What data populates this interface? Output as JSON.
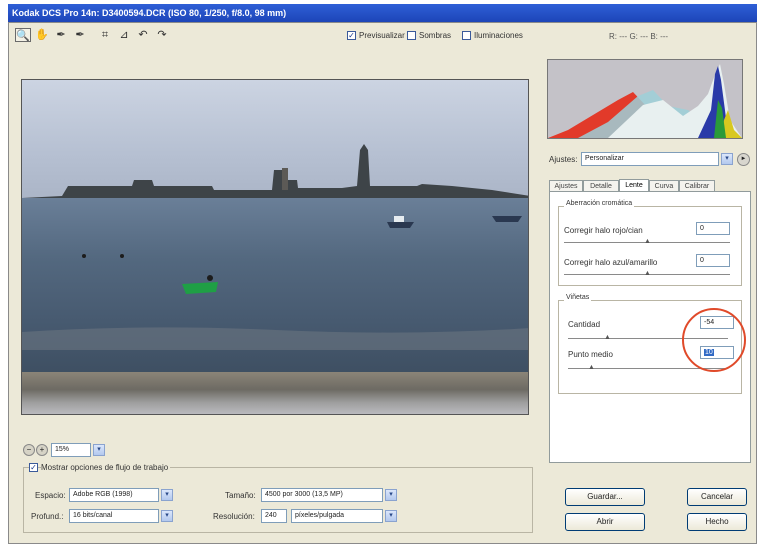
{
  "window": {
    "title": "Kodak DCS Pro 14n:  D3400594.DCR  (ISO 80, 1/250, f/8.0, 98 mm)"
  },
  "toolbar": {
    "tools": [
      {
        "name": "zoom-icon",
        "glyph": "🔍"
      },
      {
        "name": "hand-icon",
        "glyph": "✋"
      },
      {
        "name": "eyedropper-icon",
        "glyph": "✒"
      },
      {
        "name": "color-sampler-icon",
        "glyph": "✒"
      },
      {
        "name": "crop-icon",
        "glyph": "⌗"
      },
      {
        "name": "straighten-icon",
        "glyph": "⊿"
      },
      {
        "name": "rotate-left-icon",
        "glyph": "↶"
      },
      {
        "name": "rotate-right-icon",
        "glyph": "↷"
      }
    ],
    "preview_label": "Previsualizar",
    "preview_checked": "✓",
    "shadows_label": "Sombras",
    "highlights_label": "Iluminaciones",
    "rgb_readout": "R: ---    G: ---    B: ---"
  },
  "zoom": {
    "value": "15%",
    "minus": "−",
    "plus": "+"
  },
  "workflow": {
    "show_label": "Mostrar opciones de flujo de trabajo",
    "checked": "✓",
    "space_label": "Espacio:",
    "space_value": "Adobe RGB (1998)",
    "depth_label": "Profund.:",
    "depth_value": "16 bits/canal",
    "size_label": "Tamaño:",
    "size_value": "4500 por 3000  (13,5 MP)",
    "resolution_label": "Resolución:",
    "resolution_value": "240",
    "resolution_unit": "píxeles/pulgada"
  },
  "settings": {
    "label": "Ajustes:",
    "value": "Personalizar",
    "menu_glyph": "►"
  },
  "tabs": [
    "Ajustes",
    "Detalle",
    "Lente",
    "Curva",
    "Calibrar"
  ],
  "active_tab": "Lente",
  "chromatic": {
    "title": "Aberración cromática",
    "red_cyan_label": "Corregir halo rojo/cian",
    "red_cyan_value": "0",
    "blue_yellow_label": "Corregir halo azul/amarillo",
    "blue_yellow_value": "0"
  },
  "vignetting": {
    "title": "Viñetas",
    "amount_label": "Cantidad",
    "amount_value": "-54",
    "midpoint_label": "Punto medio",
    "midpoint_value": "10"
  },
  "buttons": {
    "save": "Guardar...",
    "cancel": "Cancelar",
    "open": "Abrir",
    "done": "Hecho"
  },
  "dd_glyph": "▾",
  "knob_glyph": "▲",
  "colors": {
    "title_bar": "#1d45b8",
    "highlight_circle": "#e04a2a",
    "panel_bg": "#ece9d8"
  }
}
